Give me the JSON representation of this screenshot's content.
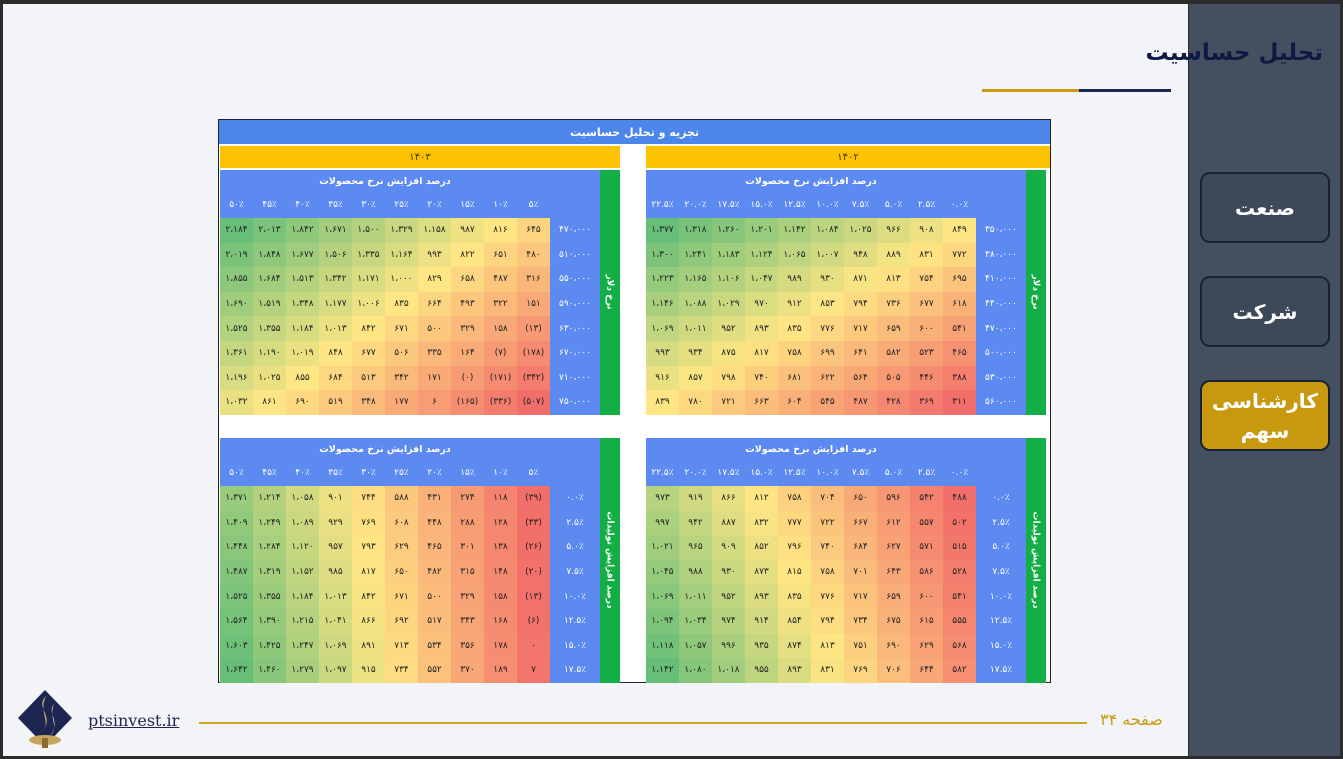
{
  "page": {
    "title": "تحلیل حساسیت",
    "site": "ptsinvest.ir",
    "page_label": "صفحه ۳۴"
  },
  "nav": {
    "items": [
      {
        "label": "صنعت",
        "active": false
      },
      {
        "label": "شرکت",
        "active": false
      },
      {
        "label": "کارشناسی سهم",
        "active": true
      }
    ]
  },
  "table": {
    "title": "تجزیه و تحلیل حساسیت",
    "year_right": "۱۴۰۲",
    "year_left": "۱۴۰۳",
    "subheader": "درصد افزایش نرخ محصولات",
    "dollar_label": "نرخ دلار",
    "production_label": "درصد افزایش تولیدات",
    "right_cols": [
      "۰.۰٪",
      "۲.۵٪",
      "۵.۰٪",
      "۷.۵٪",
      "۱۰.۰٪",
      "۱۲.۵٪",
      "۱۵.۰٪",
      "۱۷.۵٪",
      "۲۰.۰٪",
      "۲۲.۵٪"
    ],
    "left_cols": [
      "۵٪",
      "۱۰٪",
      "۱۵٪",
      "۲۰٪",
      "۲۵٪",
      "۳۰٪",
      "۳۵٪",
      "۴۰٪",
      "۴۵٪",
      "۵۰٪"
    ],
    "quadrants": {
      "top_right": {
        "rows": [
          "۳۵۰،۰۰۰",
          "۳۸۰،۰۰۰",
          "۴۱۰،۰۰۰",
          "۴۴۰،۰۰۰",
          "۴۷۰،۰۰۰",
          "۵۰۰،۰۰۰",
          "۵۳۰،۰۰۰",
          "۵۶۰،۰۰۰"
        ],
        "values": [
          [
            "۸۴۹",
            "۹۰۸",
            "۹۶۶",
            "۱،۰۲۵",
            "۱،۰۸۴",
            "۱،۱۴۲",
            "۱،۲۰۱",
            "۱،۲۶۰",
            "۱،۳۱۸",
            "۱،۳۷۷"
          ],
          [
            "۷۷۲",
            "۸۳۱",
            "۸۸۹",
            "۹۴۸",
            "۱،۰۰۷",
            "۱،۰۶۵",
            "۱،۱۲۴",
            "۱،۱۸۳",
            "۱،۲۴۱",
            "۱،۳۰۰"
          ],
          [
            "۶۹۵",
            "۷۵۴",
            "۸۱۳",
            "۸۷۱",
            "۹۳۰",
            "۹۸۹",
            "۱،۰۴۷",
            "۱،۱۰۶",
            "۱،۱۶۵",
            "۱،۲۲۳"
          ],
          [
            "۶۱۸",
            "۶۷۷",
            "۷۳۶",
            "۷۹۴",
            "۸۵۳",
            "۹۱۲",
            "۹۷۰",
            "۱،۰۲۹",
            "۱،۰۸۸",
            "۱،۱۴۶"
          ],
          [
            "۵۴۱",
            "۶۰۰",
            "۶۵۹",
            "۷۱۷",
            "۷۷۶",
            "۸۳۵",
            "۸۹۳",
            "۹۵۲",
            "۱،۰۱۱",
            "۱،۰۶۹"
          ],
          [
            "۴۶۵",
            "۵۲۳",
            "۵۸۲",
            "۶۴۱",
            "۶۹۹",
            "۷۵۸",
            "۸۱۷",
            "۸۷۵",
            "۹۳۴",
            "۹۹۳"
          ],
          [
            "۳۸۸",
            "۴۴۶",
            "۵۰۵",
            "۵۶۴",
            "۶۲۲",
            "۶۸۱",
            "۷۴۰",
            "۷۹۸",
            "۸۵۷",
            "۹۱۶"
          ],
          [
            "۳۱۱",
            "۳۶۹",
            "۴۲۸",
            "۴۸۷",
            "۵۴۵",
            "۶۰۴",
            "۶۶۳",
            "۷۲۱",
            "۷۸۰",
            "۸۳۹"
          ]
        ]
      },
      "top_left": {
        "rows": [
          "۴۷۰،۰۰۰",
          "۵۱۰،۰۰۰",
          "۵۵۰،۰۰۰",
          "۵۹۰،۰۰۰",
          "۶۳۰،۰۰۰",
          "۶۷۰،۰۰۰",
          "۷۱۰،۰۰۰",
          "۷۵۰،۰۰۰"
        ],
        "values": [
          [
            "۶۴۵",
            "۸۱۶",
            "۹۸۷",
            "۱،۱۵۸",
            "۱،۳۲۹",
            "۱،۵۰۰",
            "۱،۶۷۱",
            "۱،۸۴۲",
            "۲،۰۱۳",
            "۲،۱۸۴"
          ],
          [
            "۴۸۰",
            "۶۵۱",
            "۸۲۲",
            "۹۹۳",
            "۱،۱۶۴",
            "۱،۳۳۵",
            "۱،۵۰۶",
            "۱،۶۷۷",
            "۱،۸۴۸",
            "۲،۰۱۹"
          ],
          [
            "۳۱۶",
            "۴۸۷",
            "۶۵۸",
            "۸۲۹",
            "۱،۰۰۰",
            "۱،۱۷۱",
            "۱،۳۴۲",
            "۱،۵۱۳",
            "۱،۶۸۴",
            "۱،۸۵۵"
          ],
          [
            "۱۵۱",
            "۳۲۲",
            "۴۹۳",
            "۶۶۴",
            "۸۳۵",
            "۱،۰۰۶",
            "۱،۱۷۷",
            "۱،۳۴۸",
            "۱،۵۱۹",
            "۱،۶۹۰"
          ],
          [
            "(۱۳)",
            "۱۵۸",
            "۳۲۹",
            "۵۰۰",
            "۶۷۱",
            "۸۴۲",
            "۱،۰۱۳",
            "۱،۱۸۴",
            "۱،۳۵۵",
            "۱،۵۲۵"
          ],
          [
            "(۱۷۸)",
            "(۷)",
            "۱۶۴",
            "۳۳۵",
            "۵۰۶",
            "۶۷۷",
            "۸۴۸",
            "۱،۰۱۹",
            "۱،۱۹۰",
            "۱،۳۶۱"
          ],
          [
            "(۳۴۲)",
            "(۱۷۱)",
            "(۰)",
            "۱۷۱",
            "۳۴۲",
            "۵۱۳",
            "۶۸۴",
            "۸۵۵",
            "۱،۰۲۵",
            "۱،۱۹۶"
          ],
          [
            "(۵۰۷)",
            "(۳۳۶)",
            "(۱۶۵)",
            "۶",
            "۱۷۷",
            "۳۴۸",
            "۵۱۹",
            "۶۹۰",
            "۸۶۱",
            "۱،۰۳۲"
          ]
        ]
      },
      "bottom_right": {
        "rows": [
          "۰.۰٪",
          "۲.۵٪",
          "۵.۰٪",
          "۷.۵٪",
          "۱۰.۰٪",
          "۱۲.۵٪",
          "۱۵.۰٪",
          "۱۷.۵٪"
        ],
        "values": [
          [
            "۴۸۸",
            "۵۴۲",
            "۵۹۶",
            "۶۵۰",
            "۷۰۴",
            "۷۵۸",
            "۸۱۲",
            "۸۶۶",
            "۹۱۹",
            "۹۷۳"
          ],
          [
            "۵۰۲",
            "۵۵۷",
            "۶۱۲",
            "۶۶۷",
            "۷۲۲",
            "۷۷۷",
            "۸۳۲",
            "۸۸۷",
            "۹۴۲",
            "۹۹۷"
          ],
          [
            "۵۱۵",
            "۵۷۱",
            "۶۲۷",
            "۶۸۴",
            "۷۴۰",
            "۷۹۶",
            "۸۵۲",
            "۹۰۹",
            "۹۶۵",
            "۱،۰۲۱"
          ],
          [
            "۵۲۸",
            "۵۸۶",
            "۶۴۳",
            "۷۰۱",
            "۷۵۸",
            "۸۱۵",
            "۸۷۳",
            "۹۳۰",
            "۹۸۸",
            "۱،۰۴۵"
          ],
          [
            "۵۴۱",
            "۶۰۰",
            "۶۵۹",
            "۷۱۷",
            "۷۷۶",
            "۸۳۵",
            "۸۹۳",
            "۹۵۲",
            "۱،۰۱۱",
            "۱،۰۶۹"
          ],
          [
            "۵۵۵",
            "۶۱۵",
            "۶۷۵",
            "۷۳۴",
            "۷۹۴",
            "۸۵۴",
            "۹۱۴",
            "۹۷۴",
            "۱،۰۳۴",
            "۱،۰۹۴"
          ],
          [
            "۵۶۸",
            "۶۲۹",
            "۶۹۰",
            "۷۵۱",
            "۸۱۳",
            "۸۷۴",
            "۹۳۵",
            "۹۹۶",
            "۱،۰۵۷",
            "۱،۱۱۸"
          ],
          [
            "۵۸۲",
            "۶۴۴",
            "۷۰۶",
            "۷۶۹",
            "۸۳۱",
            "۸۹۳",
            "۹۵۵",
            "۱،۰۱۸",
            "۱،۰۸۰",
            "۱،۱۴۲"
          ]
        ]
      },
      "bottom_left": {
        "rows": [
          "۰.۰٪",
          "۲.۵٪",
          "۵.۰٪",
          "۷.۵٪",
          "۱۰.۰٪",
          "۱۲.۵٪",
          "۱۵.۰٪",
          "۱۷.۵٪"
        ],
        "values": [
          [
            "(۳۹)",
            "۱۱۸",
            "۲۷۴",
            "۴۳۱",
            "۵۸۸",
            "۷۴۴",
            "۹۰۱",
            "۱،۰۵۸",
            "۱،۲۱۴",
            "۱،۳۷۱"
          ],
          [
            "(۳۳)",
            "۱۲۸",
            "۲۸۸",
            "۴۴۸",
            "۶۰۸",
            "۷۶۹",
            "۹۲۹",
            "۱،۰۸۹",
            "۱،۲۴۹",
            "۱،۴۰۹"
          ],
          [
            "(۲۶)",
            "۱۳۸",
            "۳۰۱",
            "۴۶۵",
            "۶۲۹",
            "۷۹۳",
            "۹۵۷",
            "۱،۱۲۰",
            "۱،۲۸۴",
            "۱،۴۴۸"
          ],
          [
            "(۲۰)",
            "۱۴۸",
            "۳۱۵",
            "۴۸۲",
            "۶۵۰",
            "۸۱۷",
            "۹۸۵",
            "۱،۱۵۲",
            "۱،۳۱۹",
            "۱،۴۸۷"
          ],
          [
            "(۱۳)",
            "۱۵۸",
            "۳۲۹",
            "۵۰۰",
            "۶۷۱",
            "۸۴۲",
            "۱،۰۱۳",
            "۱،۱۸۴",
            "۱،۳۵۵",
            "۱،۵۲۵"
          ],
          [
            "(۶)",
            "۱۶۸",
            "۳۴۳",
            "۵۱۷",
            "۶۹۲",
            "۸۶۶",
            "۱،۰۴۱",
            "۱،۲۱۵",
            "۱،۳۹۰",
            "۱،۵۶۴"
          ],
          [
            "۰",
            "۱۷۸",
            "۳۵۶",
            "۵۳۴",
            "۷۱۳",
            "۸۹۱",
            "۱،۰۶۹",
            "۱،۲۴۷",
            "۱،۴۲۵",
            "۱،۶۰۳"
          ],
          [
            "۷",
            "۱۸۹",
            "۳۷۰",
            "۵۵۲",
            "۷۳۴",
            "۹۱۵",
            "۱،۰۹۷",
            "۱،۲۷۹",
            "۱،۴۶۰",
            "۱،۶۴۲"
          ]
        ]
      }
    }
  },
  "colors": {
    "accent": "#c99a13",
    "navy": "#1d2653",
    "header_blue": "#5c8af0",
    "year_gold": "#fcc100",
    "axis_green": "#13ae46"
  }
}
